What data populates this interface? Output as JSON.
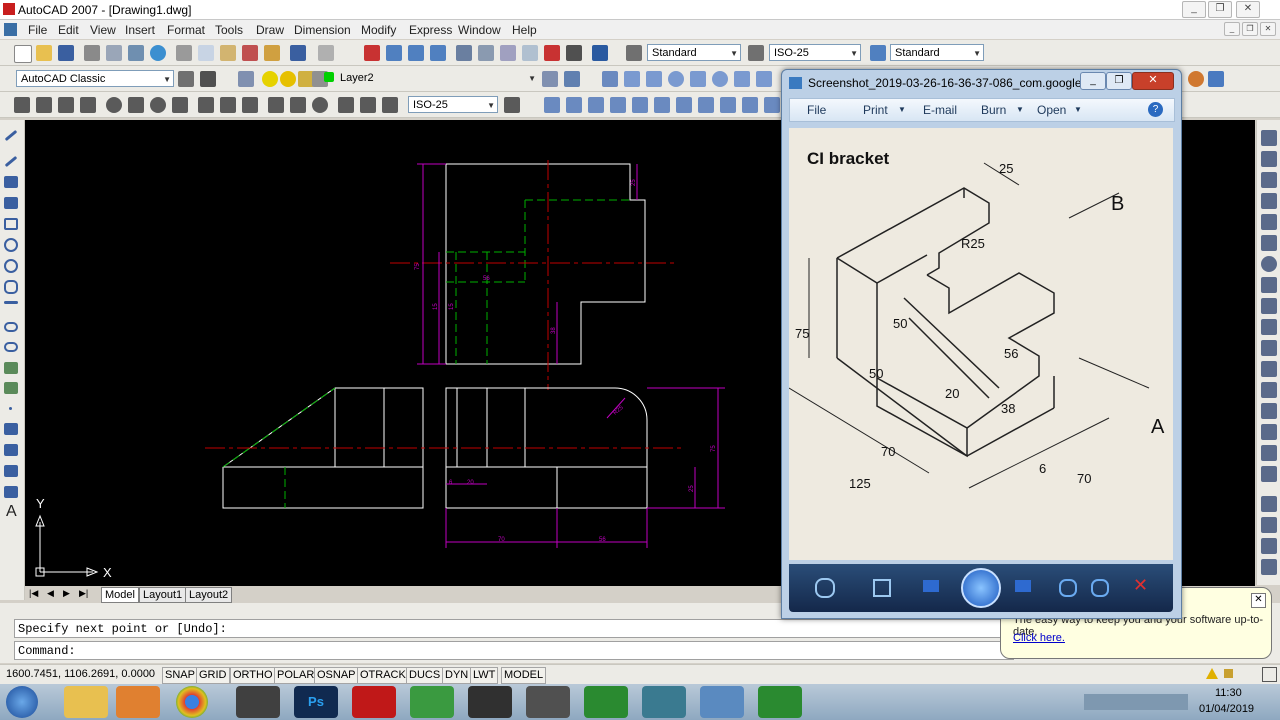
{
  "app": {
    "title": "AutoCAD 2007 - [Drawing1.dwg]",
    "colors": {
      "canvas": "#000000",
      "drawing": "#ffffff",
      "hidden": "#00b000",
      "center": "#c00000",
      "dimension": "#c000c0",
      "accent": "#1e5aa8"
    }
  },
  "menu": [
    "File",
    "Edit",
    "View",
    "Insert",
    "Format",
    "Tools",
    "Draw",
    "Dimension",
    "Modify",
    "Express",
    "Window",
    "Help"
  ],
  "toolbar": {
    "text_style": "Standard",
    "dim_style": "ISO-25",
    "table_style": "Standard",
    "workspace": "AutoCAD Classic",
    "layer": "Layer2",
    "dim_style2": "ISO-25"
  },
  "drawing": {
    "dims": {
      "d1": "75",
      "d2": "15",
      "d3": "38",
      "d4": "70",
      "d5": "56",
      "d6": "75",
      "d7": "25",
      "d8": "25",
      "d9": "6",
      "d10": "20",
      "d11": "R25",
      "d12": "56",
      "d13": "15"
    },
    "axis": {
      "x": "X",
      "y": "Y"
    }
  },
  "tabs": [
    "Model",
    "Layout1",
    "Layout2"
  ],
  "command": {
    "line1": "Specify next point or [Undo]:",
    "line2": "Command:"
  },
  "status": {
    "coords": "1600.7451, 1106.2691, 0.0000",
    "buttons": [
      "SNAP",
      "GRID",
      "ORTHO",
      "POLAR",
      "OSNAP",
      "OTRACK",
      "DUCS",
      "DYN",
      "LWT",
      "MODEL"
    ]
  },
  "viewer": {
    "title": "Screenshot_2019-03-26-16-36-37-086_com.google....",
    "menu": [
      "File",
      "Print",
      "E-mail",
      "Burn",
      "Open"
    ],
    "image_title": "CI bracket",
    "labels": {
      "l25": "25",
      "r25": "R25",
      "b": "B",
      "a": "A",
      "l75": "75",
      "l50a": "50",
      "l50b": "50",
      "l56": "56",
      "l20": "20",
      "l38": "38",
      "l70a": "70",
      "l125": "125",
      "l6": "6",
      "l70b": "70"
    }
  },
  "notification": {
    "text": "The easy way to keep you and your software up-to-date.",
    "link": "Click here."
  },
  "taskbar": {
    "time": "11:30",
    "date": "01/04/2019"
  }
}
